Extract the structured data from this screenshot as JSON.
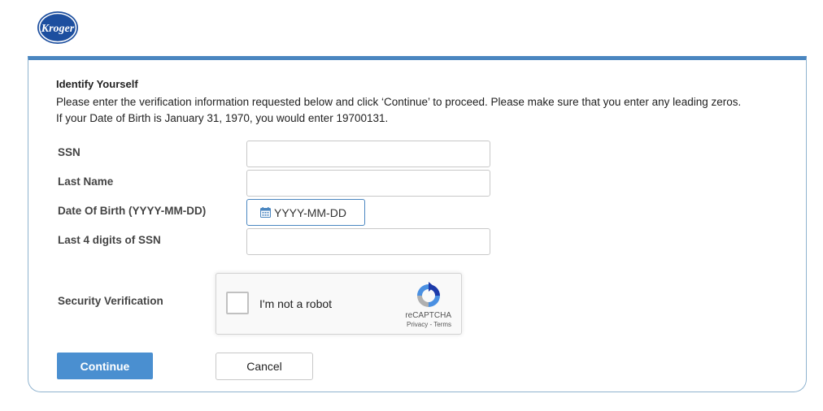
{
  "brand": {
    "logo_text": "Kroger",
    "logo_color": "#1d4f9f"
  },
  "form": {
    "heading": "Identify Yourself",
    "instruction_line1": "Please enter the verification information requested below and click ‘Continue’ to proceed. Please make sure that you enter any leading zeros.",
    "instruction_line2": "If your Date of Birth is January 31, 1970, you would enter 19700131.",
    "fields": {
      "ssn": {
        "label": "SSN",
        "value": ""
      },
      "last_name": {
        "label": "Last Name",
        "value": ""
      },
      "dob": {
        "label": "Date Of Birth (YYYY-MM-DD)",
        "placeholder": "YYYY-MM-DD",
        "value": ""
      },
      "last4": {
        "label": "Last 4 digits of SSN",
        "value": ""
      }
    },
    "security": {
      "label": "Security Verification",
      "checkbox_text": "I'm not a robot",
      "brand": "reCAPTCHA",
      "links": "Privacy - Terms",
      "checked": false
    },
    "buttons": {
      "continue": "Continue",
      "cancel": "Cancel"
    }
  },
  "colors": {
    "accent": "#4a86c0",
    "button": "#4a8fd0",
    "border": "#8fb3cf"
  }
}
